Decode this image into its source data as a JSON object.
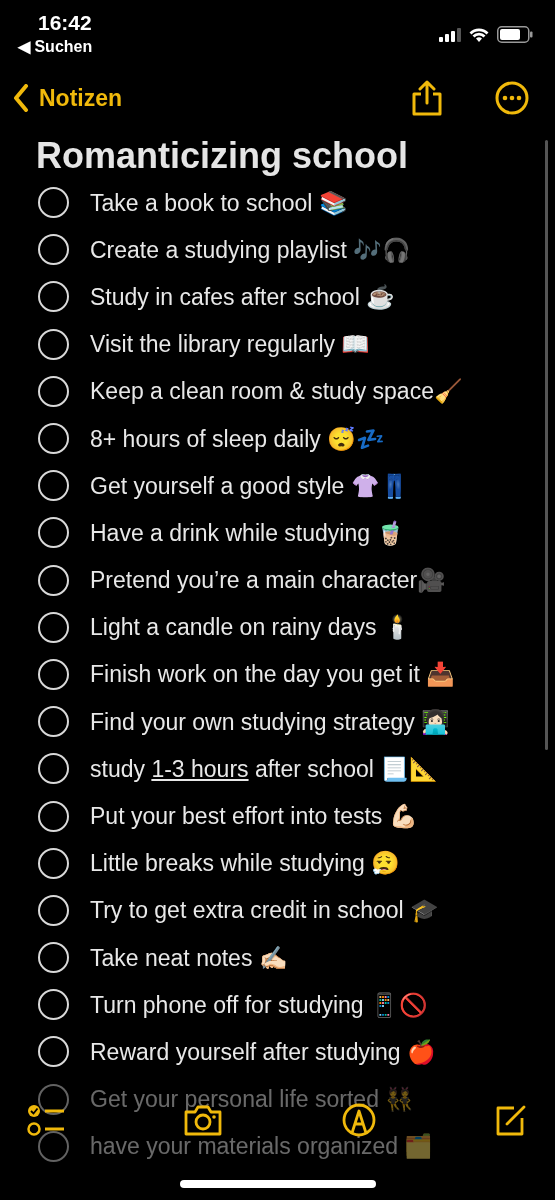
{
  "status_bar": {
    "time": "16:42",
    "back_app": "◀ Suchen"
  },
  "nav": {
    "back_label": "Notizen"
  },
  "note": {
    "title": "Romanticizing school",
    "items": [
      {
        "text": "Take a book to school 📚",
        "checked": false
      },
      {
        "text": "Create a studying playlist 🎶🎧",
        "checked": false
      },
      {
        "text": "Study in cafes after school ☕",
        "checked": false
      },
      {
        "text": "Visit the library regularly 📖",
        "checked": false
      },
      {
        "text": "Keep a clean room & study space🧹",
        "checked": false
      },
      {
        "text": "8+ hours of sleep daily 😴💤",
        "checked": false
      },
      {
        "text": "Get yourself a good style 👚👖",
        "checked": false
      },
      {
        "text": "Have a drink while studying 🧋",
        "checked": false
      },
      {
        "text": "Pretend you’re a main character🎥",
        "checked": false
      },
      {
        "text": "Light a candle on rainy days 🕯️",
        "checked": false
      },
      {
        "text": "Finish work on the day you get it 📥",
        "checked": false
      },
      {
        "text": "Find your own studying strategy 👩🏻‍💻",
        "checked": false
      },
      {
        "parts": [
          {
            "text": "study "
          },
          {
            "text": "1-3 hours",
            "link": true
          },
          {
            "text": " after school 📃📐"
          }
        ],
        "checked": false
      },
      {
        "text": "Put your best effort into tests 💪🏻",
        "checked": false
      },
      {
        "text": "Little breaks while studying 😮‍💨",
        "checked": false
      },
      {
        "text": "Try to get extra credit in school 🎓",
        "checked": false
      },
      {
        "text": "Take neat notes ✍🏻",
        "checked": false
      },
      {
        "text": "Turn phone off for studying 📱🚫",
        "checked": false
      },
      {
        "text": "Reward yourself after studying 🍎",
        "checked": false
      },
      {
        "text": "Get your personal life sorted 👯",
        "checked": false,
        "faded": true
      },
      {
        "text": "have your materials organized 🗂️",
        "checked": false,
        "faded": true
      }
    ]
  }
}
